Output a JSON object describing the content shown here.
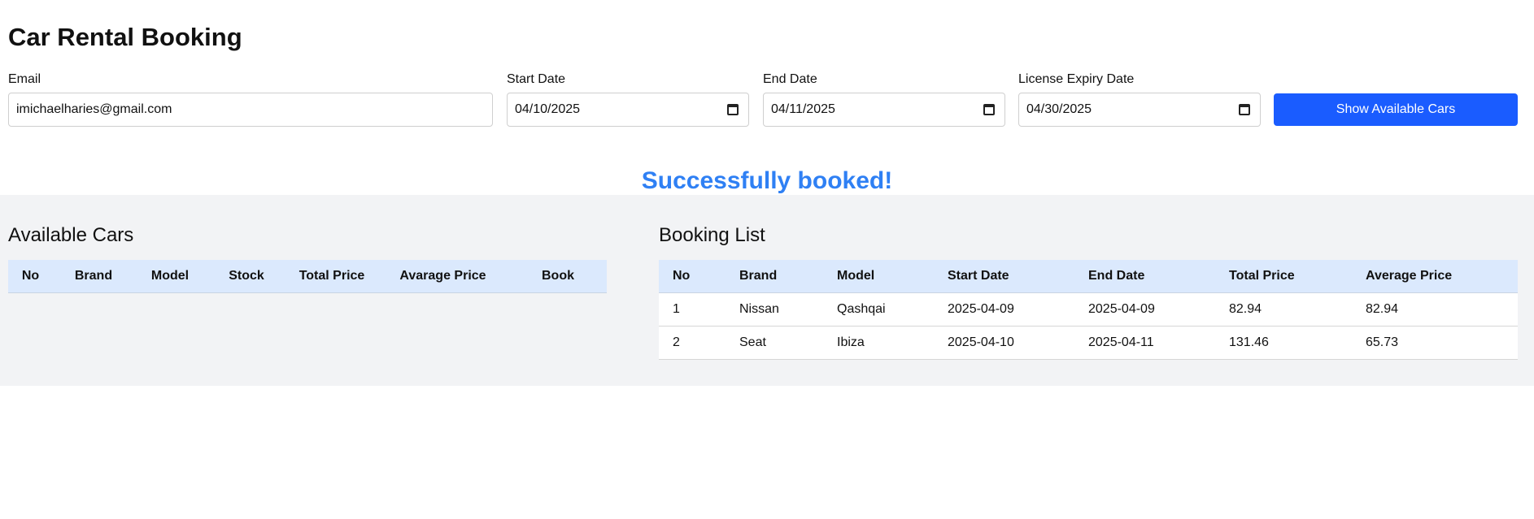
{
  "header": {
    "title": "Car Rental Booking"
  },
  "form": {
    "email": {
      "label": "Email",
      "value": "imichaelharies@gmail.com"
    },
    "start_date": {
      "label": "Start Date",
      "value": "04/10/2025",
      "icon": "calendar-icon"
    },
    "end_date": {
      "label": "End Date",
      "value": "04/11/2025",
      "icon": "calendar-icon"
    },
    "license_expiry": {
      "label": "License Expiry Date",
      "value": "04/30/2025",
      "icon": "calendar-icon"
    },
    "submit_label": "Show Available Cars"
  },
  "status": {
    "message": "Successfully booked!",
    "color": "#2f80f4"
  },
  "available_cars": {
    "title": "Available Cars",
    "columns": [
      "No",
      "Brand",
      "Model",
      "Stock",
      "Total Price",
      "Avarage Price",
      "Book"
    ],
    "rows": []
  },
  "booking_list": {
    "title": "Booking List",
    "columns": [
      "No",
      "Brand",
      "Model",
      "Start Date",
      "End Date",
      "Total Price",
      "Average Price"
    ],
    "rows": [
      [
        "1",
        "Nissan",
        "Qashqai",
        "2025-04-09",
        "2025-04-09",
        "82.94",
        "82.94"
      ],
      [
        "2",
        "Seat",
        "Ibiza",
        "2025-04-10",
        "2025-04-11",
        "131.46",
        "65.73"
      ]
    ]
  },
  "colors": {
    "primary_button": "#1a5cff",
    "table_header_bg": "#dbe9fd",
    "section_bg": "#f2f3f5"
  }
}
